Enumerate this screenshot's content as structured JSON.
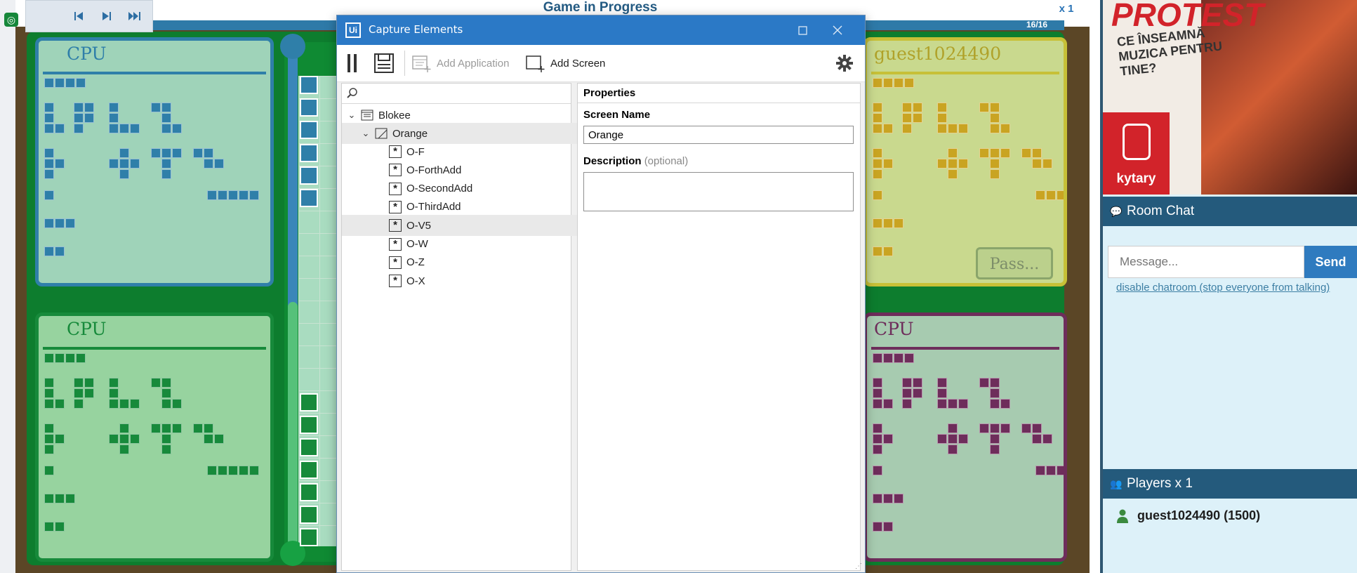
{
  "game": {
    "title": "Game in Progress",
    "speed": "x 1",
    "progress": "16/16",
    "pass_label": "Pass...",
    "panels": {
      "blue_name": "CPU",
      "green_name": "CPU",
      "yellow_name": "guest1024490",
      "purple_name": "CPU"
    },
    "colors": {
      "blue": "#2f7fa9",
      "green": "#178a3b",
      "yellow": "#c7b52a",
      "purple": "#6e2d5b",
      "board": "#0d7d2e"
    },
    "icons": [
      "step-back-icon",
      "step-forward-icon",
      "skip-end-icon",
      "logo-icon"
    ]
  },
  "dialog": {
    "title": "Capture Elements",
    "app_icon": "Ui",
    "toolbar": {
      "add_application": "Add Application",
      "add_screen": "Add Screen"
    },
    "tree": {
      "root": "Blokee",
      "screen": "Orange",
      "elements": [
        "O-F",
        "O-ForthAdd",
        "O-SecondAdd",
        "O-ThirdAdd",
        "O-V5",
        "O-W",
        "O-Z",
        "O-X"
      ],
      "selected": "O-V5"
    },
    "properties": {
      "header": "Properties",
      "screen_name_label": "Screen Name",
      "screen_name_value": "Orange",
      "description_label": "Description",
      "description_optional": "(optional)",
      "description_value": ""
    }
  },
  "sidebar": {
    "ad": {
      "headline": "PROTEST",
      "sub": "CE ÎNSEAMNĂ MUZICA PENTRU TINE?",
      "brand": "kytary"
    },
    "room_chat": {
      "title": "Room Chat",
      "message_placeholder": "Message...",
      "send_label": "Send",
      "disable_link": "disable chatroom (stop everyone from talking)"
    },
    "players": {
      "title": "Players x 1",
      "list": [
        "guest1024490 (1500)"
      ]
    }
  }
}
